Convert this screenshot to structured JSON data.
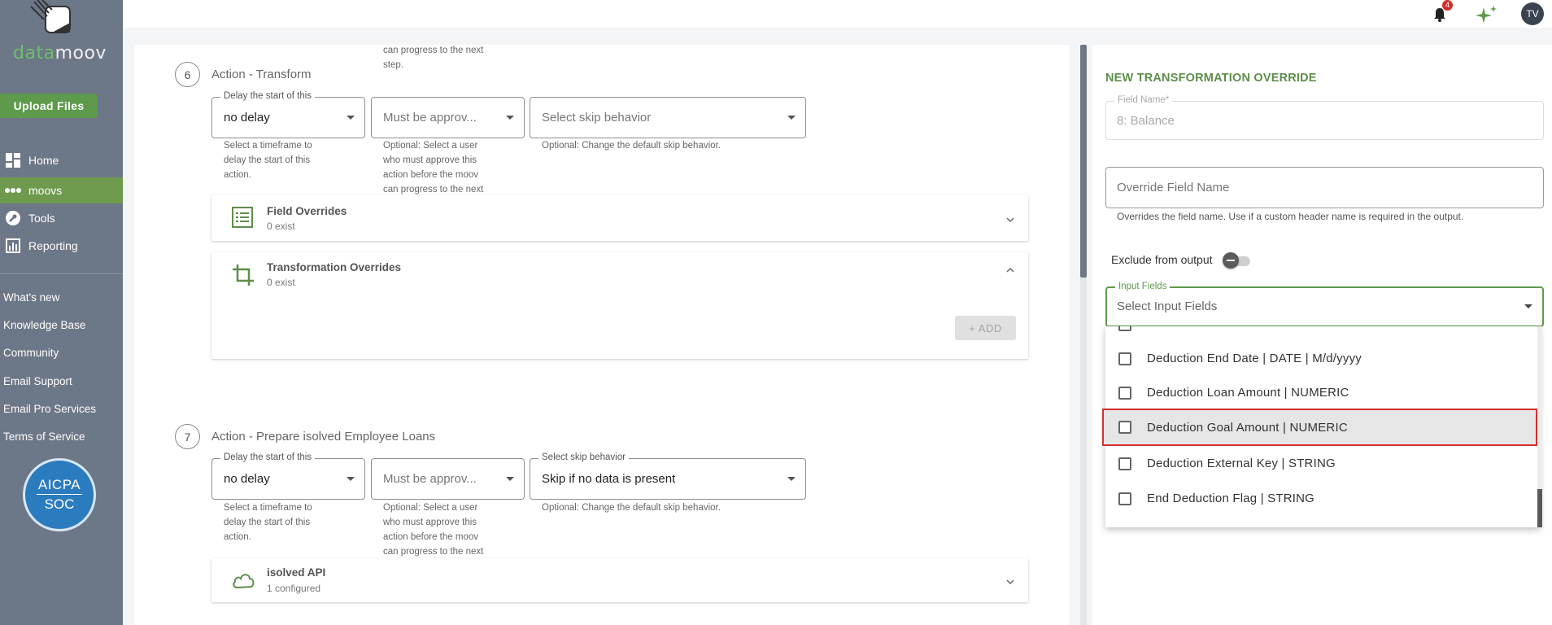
{
  "brand": {
    "logo_part1": "data",
    "logo_part2": "moov"
  },
  "sidebar": {
    "upload_label": "Upload Files",
    "nav": [
      {
        "label": "Home",
        "icon": "home-icon"
      },
      {
        "label": "moovs",
        "icon": "moovs-icon"
      },
      {
        "label": "Tools",
        "icon": "wrench-icon"
      },
      {
        "label": "Reporting",
        "icon": "chart-icon"
      }
    ],
    "links": [
      "What's new",
      "Knowledge Base",
      "Community",
      "Email Support",
      "Email Pro Services",
      "Terms of Service"
    ],
    "badge": {
      "line1": "AICPA",
      "line2": "SOC"
    }
  },
  "topbar": {
    "notification_count": "4",
    "avatar_initials": "TV"
  },
  "main": {
    "top_fragment_lines": [
      "can progress to the next",
      "step."
    ],
    "step6": {
      "number": "6",
      "title": "Action - Transform",
      "delay": {
        "label": "Delay the start of this",
        "value": "no delay",
        "help": [
          "Select a timeframe to",
          "delay the start of this",
          "action."
        ]
      },
      "approve": {
        "placeholder": "Must be approv...",
        "help": [
          "Optional: Select a user",
          "who must approve this",
          "action before the moov",
          "can progress to the next"
        ]
      },
      "skip": {
        "placeholder": "Select skip behavior",
        "help": "Optional: Change the default skip behavior."
      },
      "field_overrides": {
        "title": "Field Overrides",
        "sub": "0 exist"
      },
      "transformation_overrides": {
        "title": "Transformation Overrides",
        "sub": "0 exist",
        "add_label": "+ ADD"
      }
    },
    "step7": {
      "number": "7",
      "title": "Action - Prepare isolved Employee Loans",
      "delay": {
        "label": "Delay the start of this",
        "value": "no delay",
        "help": [
          "Select a timeframe to",
          "delay the start of this",
          "action."
        ]
      },
      "approve": {
        "placeholder": "Must be approv...",
        "help": [
          "Optional: Select a user",
          "who must approve this",
          "action before the moov",
          "can progress to the next"
        ]
      },
      "skip": {
        "label": "Select skip behavior",
        "value": "Skip if no data is present",
        "help": "Optional: Change the default skip behavior."
      },
      "api": {
        "title": "isolved API",
        "sub": "1 configured"
      }
    }
  },
  "override_panel": {
    "title": "NEW TRANSFORMATION OVERRIDE",
    "field_name": {
      "label": "Field Name*",
      "value": "8: Balance"
    },
    "override_name": {
      "placeholder": "Override Field Name",
      "help": "Overrides the field name. Use if a custom header name is required in the output."
    },
    "exclude_label": "Exclude from output",
    "input_fields": {
      "label": "Input Fields",
      "placeholder": "Select Input Fields",
      "options": [
        "Deduction End Date | DATE | M/d/yyyy",
        "Deduction Loan Amount | NUMERIC",
        "Deduction Goal Amount | NUMERIC",
        "Deduction External Key | STRING",
        "End Deduction Flag | STRING"
      ],
      "highlighted_index": 2
    }
  },
  "colors": {
    "sidebar": "#6c7787",
    "accent": "#5e9a4c",
    "highlight": "#d32f2f"
  }
}
